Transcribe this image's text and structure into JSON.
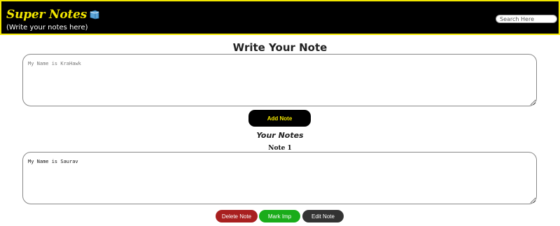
{
  "header": {
    "brand_title": "Super Notes",
    "subtitle": "(Write your notes here)",
    "search_placeholder": "Search Here"
  },
  "composer": {
    "title": "Write Your Note",
    "input_value": "",
    "input_placeholder": "My Name is KraHawk",
    "add_button": "Add Note"
  },
  "notes": {
    "heading": "Your Notes",
    "items": [
      {
        "title": "Note 1",
        "text": "My Name is Saurav",
        "delete_label": "Delete Note",
        "important_label": "Mark Imp",
        "edit_label": "Edit Note"
      }
    ]
  },
  "colors": {
    "brand_yellow": "#f2e600",
    "header_bg": "#000000",
    "delete": "#a81f1f",
    "important": "#1aac1a",
    "edit": "#333333"
  },
  "icons": {
    "brand": "book-icon"
  }
}
